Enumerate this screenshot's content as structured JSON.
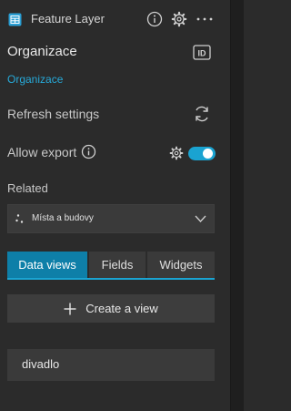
{
  "header": {
    "title": "Feature Layer",
    "icons": [
      "table-icon",
      "info-icon",
      "gear-icon",
      "more-icon"
    ]
  },
  "source": {
    "name": "Organizace",
    "subtitle": "Organizace"
  },
  "settings": {
    "refresh_label": "Refresh settings",
    "export_label": "Allow export",
    "export_enabled": true
  },
  "related": {
    "label": "Related",
    "selected": "Místa a budovy"
  },
  "tabs": [
    {
      "label": "Data views",
      "active": true
    },
    {
      "label": "Fields",
      "active": false
    },
    {
      "label": "Widgets",
      "active": false
    }
  ],
  "create_view_label": "Create a view",
  "views": [
    {
      "label": "divadlo"
    }
  ],
  "colors": {
    "accent": "#1aa3d1",
    "active_tab": "#0e7fa8",
    "link": "#27a9d8"
  }
}
